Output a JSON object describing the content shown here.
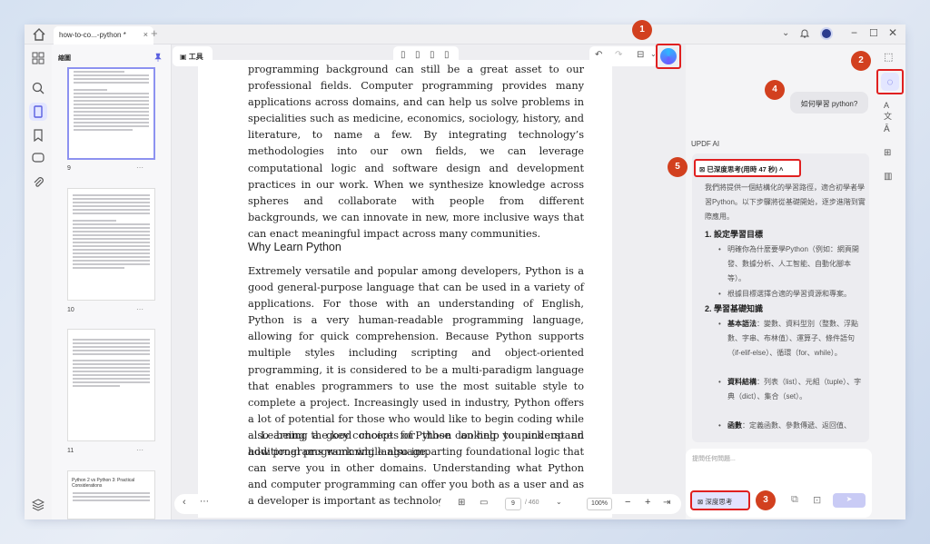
{
  "titlebar": {
    "tab_label": "how-to-co...-python *",
    "tab_close": "×",
    "tab_add": "+"
  },
  "thumbnails": {
    "title": "縮圖",
    "pages": [
      {
        "number": "9"
      },
      {
        "number": "10"
      },
      {
        "number": "11"
      }
    ],
    "last_page_heading": "Python 2 vs Python 3: Practical Considerations"
  },
  "toolbar": {
    "tools_label": "工具",
    "chat_label": "聊天"
  },
  "document": {
    "para1": "programming background can still be a great asset to our professional fields. Computer programming provides many applications across domains, and can help us solve problems in specialities such as medicine, economics, sociology, history, and literature, to name a few. By integrating technology’s methodologies into our own fields, we can leverage computational logic and software design and development practices in our work. When we synthesize knowledge across spheres and collaborate with people from different backgrounds, we can innovate in new, more inclusive ways that can enact meaningful impact across many communities.",
    "heading": "Why Learn Python",
    "para2": "Extremely versatile and popular among developers, Python is a good general-purpose language that can be used in a variety of applications. For those with an understanding of English, Python is a very human-readable programming language, allowing for quick comprehension. Because Python supports multiple styles including scripting and object-oriented programming, it is considered to be a multi-paradigm language that enables programmers to use the most suitable style to complete a project. Increasingly used in industry, Python offers a lot of potential for those who would like to begin coding while also being a good choice for those looking to pick up an additional programming language.",
    "para3": "Learning the key concepts of Python can help you understand how programs work while also imparting foundational logic that can serve you in other domains. Understanding what Python and computer programming can offer you both as a user and as a developer is important as technology is further integra"
  },
  "bottom_bar": {
    "page_current": "9",
    "page_total": "/ 460",
    "zoom": "100%",
    "zoom_minus": "−",
    "zoom_plus": "+"
  },
  "chat": {
    "user_message": "如何學習 python?",
    "ai_label": "UPDF AI",
    "thinking_label": "已深度思考(用時 47 秒)",
    "intro": "我們將提供一個結構化的學習路徑，適合初學者學習Python。以下步驟將從基礎開始，逐步進階到實際應用。",
    "section1_title": "1. 設定學習目標",
    "section1_items": [
      "明確你為什麼要學Python（例如：網頁開發、數據分析、人工智能、自動化腳本等）。",
      "根據目標選擇合適的學習資源和專案。"
    ],
    "section2_title": "2. 學習基礎知識",
    "section2_items": [
      {
        "label": "基本語法",
        "text": "：變數、資料型別（整數、浮點數、字串、布林值）、運算子、條件語句（if-elif-else）、循環（for、while）。"
      },
      {
        "label": "資料結構",
        "text": "：列表（list）、元組（tuple）、字典（dict）、集合（set）。"
      },
      {
        "label": "函數",
        "text": "：定義函數、參數傳遞、返回值、"
      }
    ],
    "input_placeholder": "提問任何問題...",
    "deep_think_label": "深度思考"
  },
  "annotations": {
    "badges": [
      "1",
      "2",
      "3",
      "4",
      "5"
    ],
    "badge_color": "#d2401f",
    "highlight_color": "#e02020"
  }
}
